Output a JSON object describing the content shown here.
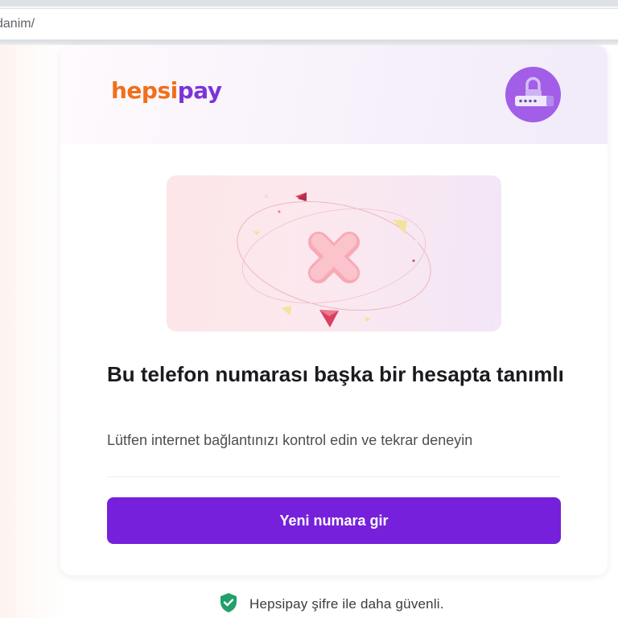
{
  "browser": {
    "url_fragment": "danim/"
  },
  "card": {
    "brand": {
      "part1": "hepsi",
      "part2": "pay"
    },
    "header_icon": "lock-keypad-icon",
    "illustration_icon": "error-x-icon",
    "title": "Bu telefon numarası başka bir hesapta tanımlı",
    "subtitle": "Lütfen internet bağlantınızı kontrol edin ve tekrar deneyin",
    "primary_button_label": "Yeni numara gir"
  },
  "footer": {
    "icon": "shield-check-icon",
    "text": "Hepsipay şifre ile daha güvenli."
  },
  "colors": {
    "brand_orange": "#f06f1c",
    "brand_purple": "#7b34d8",
    "button_purple": "#7620db",
    "badge_purple": "#a35ee8",
    "error_pink": "#f2a0ae",
    "shield_green": "#22a06b"
  }
}
